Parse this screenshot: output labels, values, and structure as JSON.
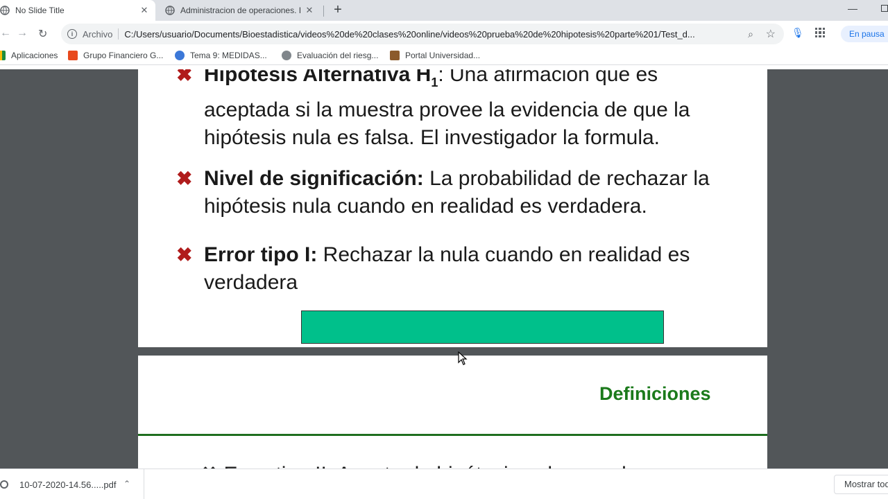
{
  "browser": {
    "tabs": [
      {
        "title": "No Slide Title"
      },
      {
        "title": "Administracion de operaciones. I"
      }
    ],
    "new_tab": "+",
    "omnibox": {
      "scheme_label": "Archivo",
      "url": "C:/Users/usuario/Documents/Bioestadistica/videos%20de%20clases%20online/videos%20prueba%20de%20hipotesis%20parte%201/Test_d..."
    },
    "pause_chip": "En pausa",
    "bookmarks": [
      {
        "label": "Aplicaciones",
        "color": "#d93025"
      },
      {
        "label": "Grupo Financiero G...",
        "color": "#e8491d"
      },
      {
        "label": "Tema 9: MEDIDAS...",
        "color": "#3c78d8"
      },
      {
        "label": "Evaluación del riesg...",
        "color": "#80868b"
      },
      {
        "label": "Portal Universidad...",
        "color": "#8b5a2b"
      }
    ]
  },
  "slide1": {
    "bullet_mark": "✖",
    "items": [
      {
        "bold": "Hipótesis Alternativa H",
        "bold_sub": "1",
        "text": ": Una afirmación que es aceptada si la muestra provee la evidencia de que la hipótesis nula es falsa. El investigador la formula."
      },
      {
        "bold": "Nivel de significación:",
        "text": " La probabilidad de rechazar la hipótesis nula cuando en realidad es verdadera."
      },
      {
        "bold": "Error tipo I:",
        "text": " Rechazar la nula cuando en realidad es verdadera"
      }
    ],
    "box_color": "#00c08b"
  },
  "slide2": {
    "title": "Definiciones",
    "cut_text": "✖ Error tipo II: Aceptar la hipótesis nula cuando"
  },
  "downloads": {
    "file": "10-07-2020-14.56.....pdf",
    "show_all": "Mostrar todo"
  }
}
